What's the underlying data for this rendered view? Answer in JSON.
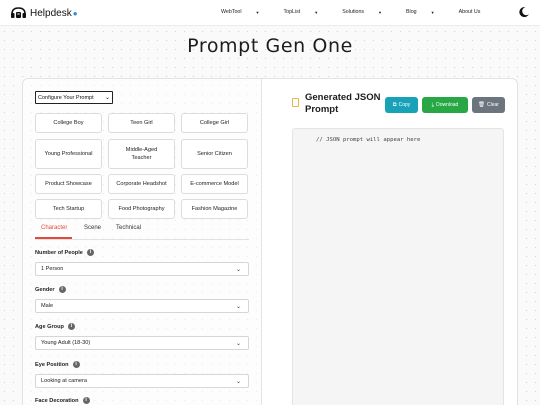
{
  "nav": {
    "brand": "Helpdesk",
    "links": [
      {
        "label": "WebTool",
        "dropdown": true
      },
      {
        "label": "TopList",
        "dropdown": true
      },
      {
        "label": "Solutions",
        "dropdown": true
      },
      {
        "label": "Blog",
        "dropdown": true
      },
      {
        "label": "About Us",
        "dropdown": false
      }
    ],
    "theme_toggle_icon": "moon-icon"
  },
  "page_title": "Prompt Gen One",
  "config": {
    "select_value": "Configure Your Prompt",
    "presets": [
      "College Boy",
      "Teen Girl",
      "College Girl",
      "Young Professional",
      "Middle-Aged Teacher",
      "Senior Citizen",
      "Product Showcase",
      "Corporate Headshot",
      "E-commerce Model",
      "Tech Startup",
      "Food Photography",
      "Fashion Magazine"
    ],
    "tabs": [
      "Character",
      "Scene",
      "Technical"
    ],
    "active_tab": "Character",
    "fields": [
      {
        "label": "Number of People",
        "value": "1 Person"
      },
      {
        "label": "Gender",
        "value": "Male"
      },
      {
        "label": "Age Group",
        "value": "Young Adult (18-30)"
      },
      {
        "label": "Eye Position",
        "value": "Looking at camera"
      },
      {
        "label": "Face Decoration",
        "value": ""
      }
    ]
  },
  "output": {
    "title": "Generated JSON Prompt",
    "buttons": {
      "copy": "Copy",
      "download": "Download",
      "clear": "Clear"
    },
    "placeholder": "// JSON prompt will appear here"
  },
  "colors": {
    "accent_tab": "#e04a3a",
    "copy_button": "#17a2b8",
    "download_button": "#28a745",
    "clear_button": "#6c757d",
    "brand_dot": "#2a8de0"
  }
}
